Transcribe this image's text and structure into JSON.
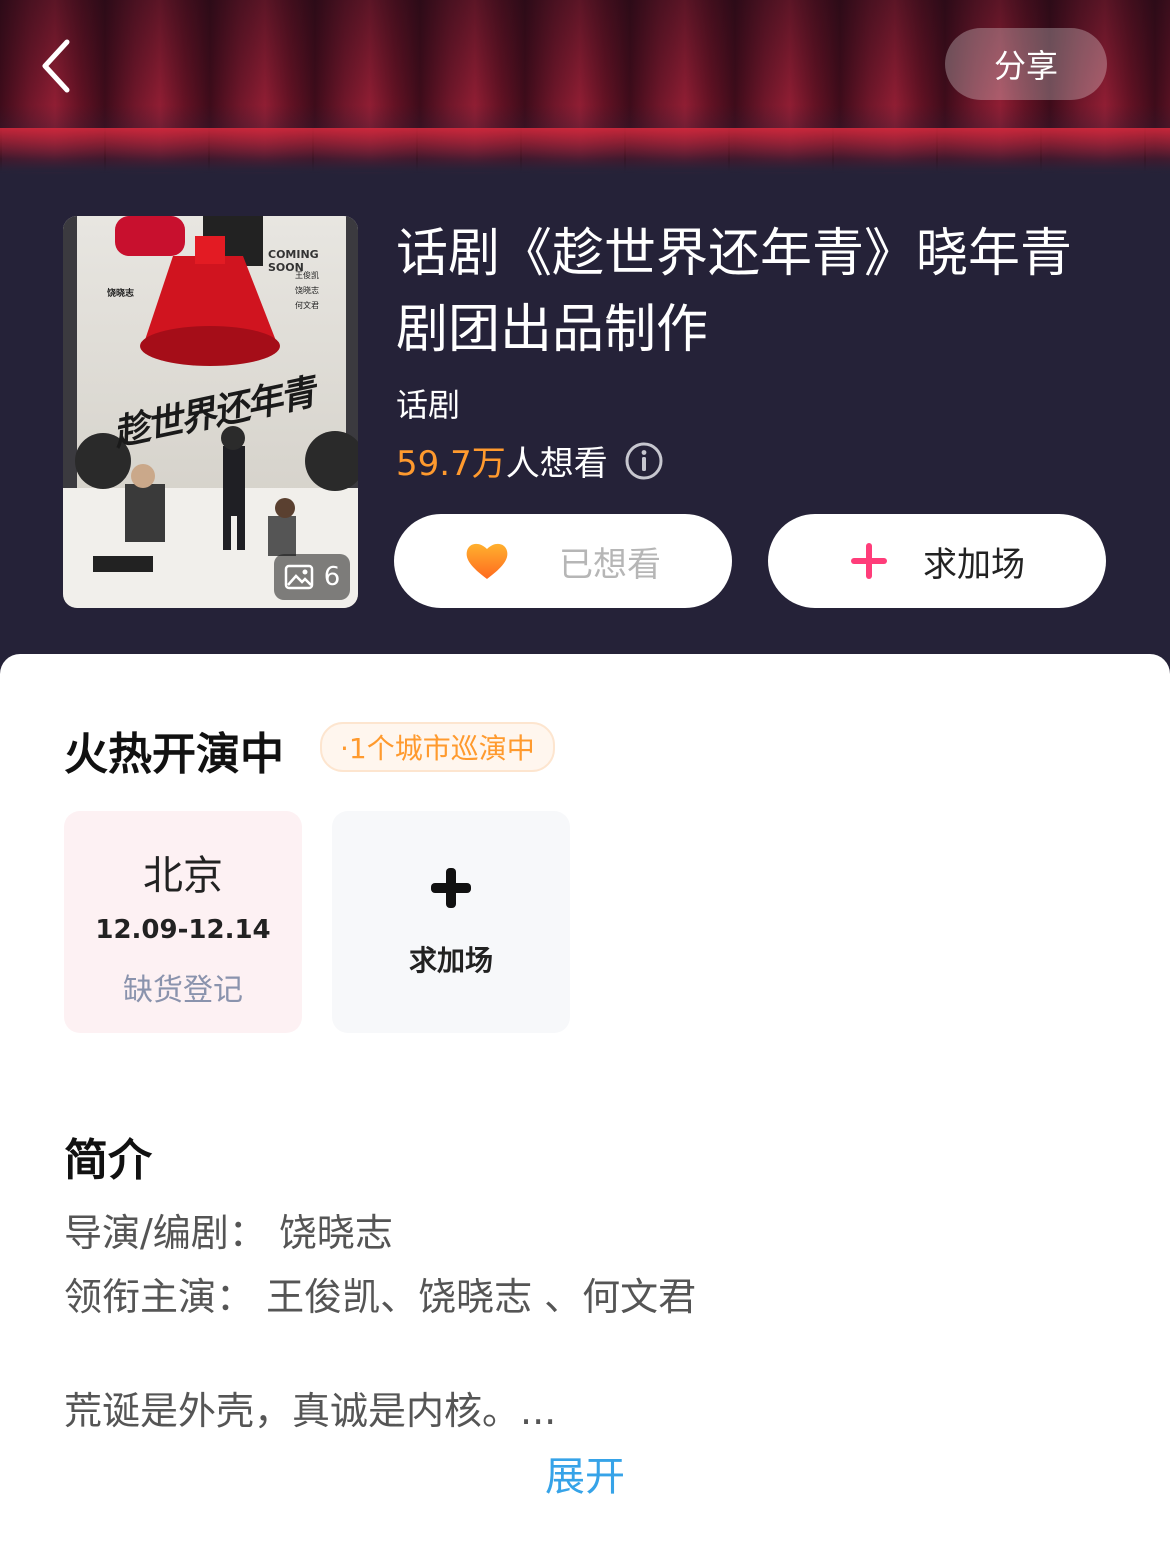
{
  "header": {
    "share_label": "分享",
    "back_icon": "chevron-left-icon"
  },
  "poster": {
    "coming_soon": "COMING SOON",
    "poster_title": "趁世界还年青",
    "director": "饶晓志",
    "credits": [
      "王俊凯",
      "饶晓志",
      "何文君"
    ],
    "image_count": "6",
    "image_icon": "image-icon"
  },
  "show": {
    "title": "话剧《趁世界还年青》晓年青剧团出品制作",
    "category": "话剧",
    "want_count": "59.7万",
    "want_text": "人想看",
    "want_button_label": "已想看",
    "add_button_label": "求加场",
    "colors": {
      "accent_orange": "#ff9a2e",
      "plus_pink": "#ff3d7a"
    }
  },
  "performing": {
    "title": "火热开演中",
    "tour_tag": "·1个城市巡演中",
    "cities": [
      {
        "name": "北京",
        "dates": "12.09-12.14",
        "status": "缺货登记"
      }
    ],
    "add_card_label": "求加场"
  },
  "intro": {
    "title": "简介",
    "director_line": "导演/编剧：  饶晓志",
    "cast_line": "领衔主演：  王俊凯、饶晓志 、何文君",
    "summary": "荒诞是外壳，真诚是内核。...",
    "expand_label": "展开",
    "expand_color": "#36a3e8"
  }
}
